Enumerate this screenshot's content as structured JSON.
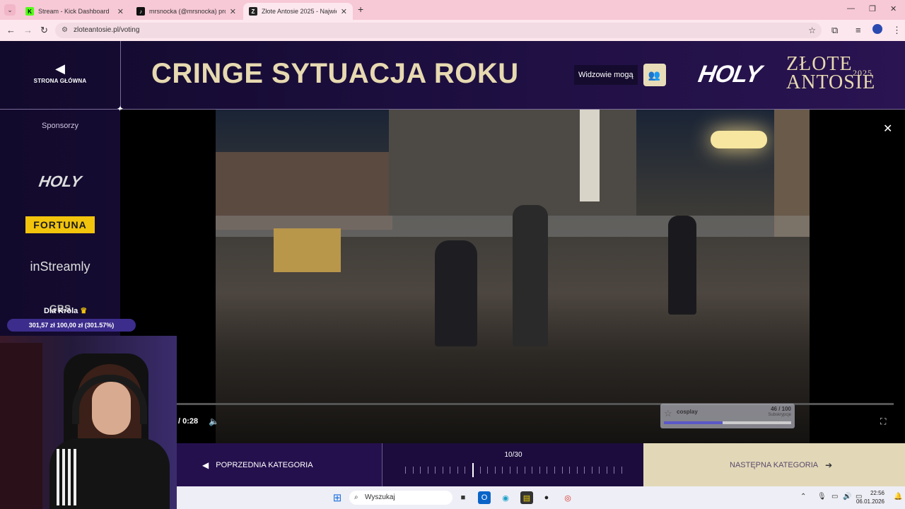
{
  "browser": {
    "tabs": [
      {
        "title": "Stream - Kick Dashboard",
        "favicon": "kick-icon",
        "favicon_color": "#53fc18"
      },
      {
        "title": "mrsnocka (@mrsnocka) prowad",
        "favicon": "tiktok-icon",
        "favicon_color": "#111111"
      },
      {
        "title": "Złote Antosie 2025 - Najwię",
        "favicon": "za-icon",
        "favicon_color": "#222222"
      }
    ],
    "new_tab": "+",
    "url": "zloteantosie.pl/voting"
  },
  "page": {
    "home_label": "STRONA GŁÓWNA",
    "category_title": "CRINGE SYTUACJA ROKU",
    "viewers_label": "Widzowie mogą",
    "brand_holy": "HOLY",
    "brand_zlote_line1": "ZŁOTE",
    "brand_zlote_line2": "ANTOSIE",
    "brand_year": "2025",
    "sponsors_label": "Sponsorzy",
    "sponsors": [
      "HOLY",
      "FORTUNA",
      "inStreamly",
      "GBS"
    ]
  },
  "video": {
    "time": "/ 0:28",
    "progress": 0.0
  },
  "sub_goal": {
    "name": "cosplay",
    "count": "46 / 100",
    "label": "Subskrypcje",
    "fraction": 0.46
  },
  "donation": {
    "name": "Dla Króla",
    "amounts": "301,57 zł   100,00 zł (301.57%)"
  },
  "category_nav": {
    "prev_label": "POPRZEDNIA KATEGORIA",
    "next_label": "NASTĘPNA KATEGORIA",
    "counter": "10/30",
    "current": 10,
    "total": 30
  },
  "taskbar": {
    "search_placeholder": "Wyszukaj",
    "time": "22:56",
    "date": "06.01.2026"
  },
  "colors": {
    "accent_gold": "#e7d9b0",
    "page_bg": "#1c0e3e"
  }
}
